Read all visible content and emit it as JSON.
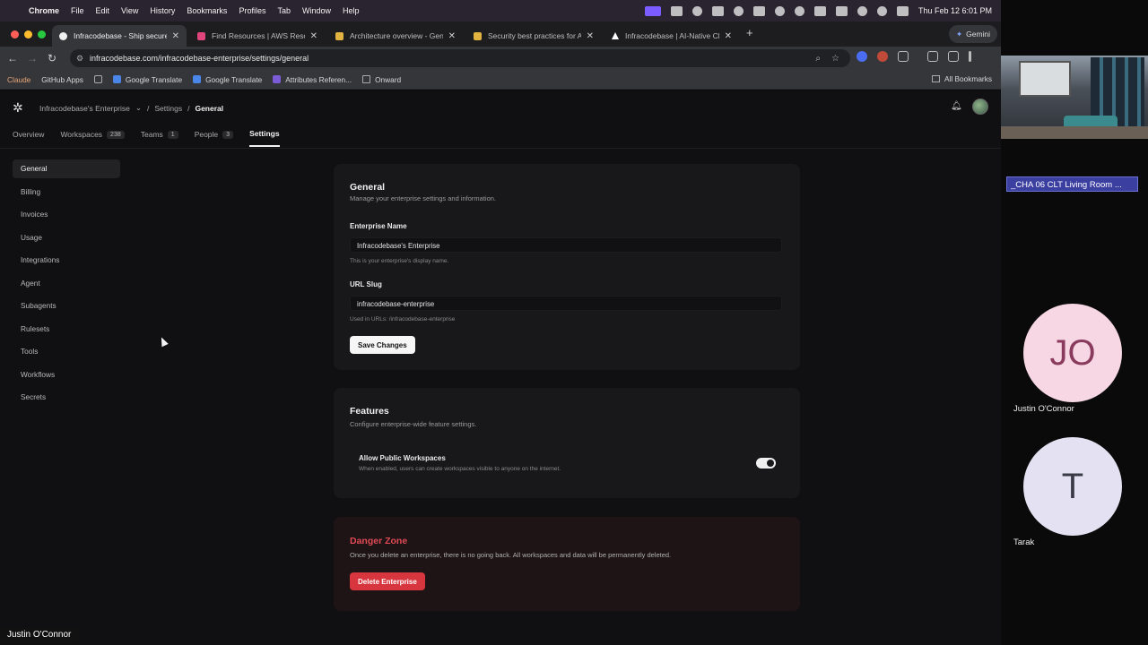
{
  "menubar": {
    "app": "Chrome",
    "items": [
      "File",
      "Edit",
      "View",
      "History",
      "Bookmarks",
      "Profiles",
      "Tab",
      "Window",
      "Help"
    ],
    "clock": "Thu Feb 12  6:01 PM"
  },
  "tabs": [
    {
      "title": "Infracodebase - Ship secure",
      "color": "#f0f0f0"
    },
    {
      "title": "Find Resources | AWS Resou",
      "color": "#e0457b"
    },
    {
      "title": "Architecture overview - Gene",
      "color": "#e3b341"
    },
    {
      "title": "Security best practices for A",
      "color": "#e3b341"
    },
    {
      "title": "Infracodebase | AI-Native Clo",
      "color": "#ffffff"
    }
  ],
  "gemini_label": "Gemini",
  "address": {
    "url": "infracodebase.com/infracodebase-enterprise/settings/general"
  },
  "bookmarks": {
    "items": [
      "Claude",
      "GitHub Apps",
      "Google Translate",
      "Google Translate",
      "Attributes Referen...",
      "Onward"
    ],
    "all": "All Bookmarks"
  },
  "app": {
    "breadcrumb": {
      "org": "Infracodebase's Enterprise",
      "section": "Settings",
      "page": "General"
    },
    "nav": [
      {
        "label": "Overview",
        "count": ""
      },
      {
        "label": "Workspaces",
        "count": "238"
      },
      {
        "label": "Teams",
        "count": "1"
      },
      {
        "label": "People",
        "count": "3"
      },
      {
        "label": "Settings",
        "count": ""
      }
    ],
    "sidebar": [
      "General",
      "Billing",
      "Invoices",
      "Usage",
      "Integrations",
      "Agent",
      "Subagents",
      "Rulesets",
      "Tools",
      "Workflows",
      "Secrets"
    ],
    "general": {
      "title": "General",
      "subtitle": "Manage your enterprise settings and information.",
      "name_label": "Enterprise Name",
      "name_value": "Infracodebase's Enterprise",
      "name_hint": "This is your enterprise's display name.",
      "slug_label": "URL Slug",
      "slug_value": "infracodebase-enterprise",
      "slug_hint": "Used in URLs: /infracodebase-enterprise",
      "save": "Save Changes"
    },
    "features": {
      "title": "Features",
      "subtitle": "Configure enterprise-wide feature settings.",
      "public_label": "Allow Public Workspaces",
      "public_desc": "When enabled, users can create workspaces visible to anyone on the internet.",
      "public_enabled": true
    },
    "danger": {
      "title": "Danger Zone",
      "text": "Once you delete an enterprise, there is no going back. All workspaces and data will be permanently deleted.",
      "button": "Delete Enterprise"
    }
  },
  "meeting": {
    "room": "_CHA 06 CLT Living Room ...",
    "participants": [
      {
        "initials": "JO",
        "name": "Justin O'Connor",
        "bg": "#f6d7e3",
        "fg": "#8a3a5c"
      },
      {
        "initials": "T",
        "name": "Tarak",
        "bg": "#e4e1f2",
        "fg": "#3a3a46"
      }
    ],
    "speaker": "Justin O'Connor"
  }
}
